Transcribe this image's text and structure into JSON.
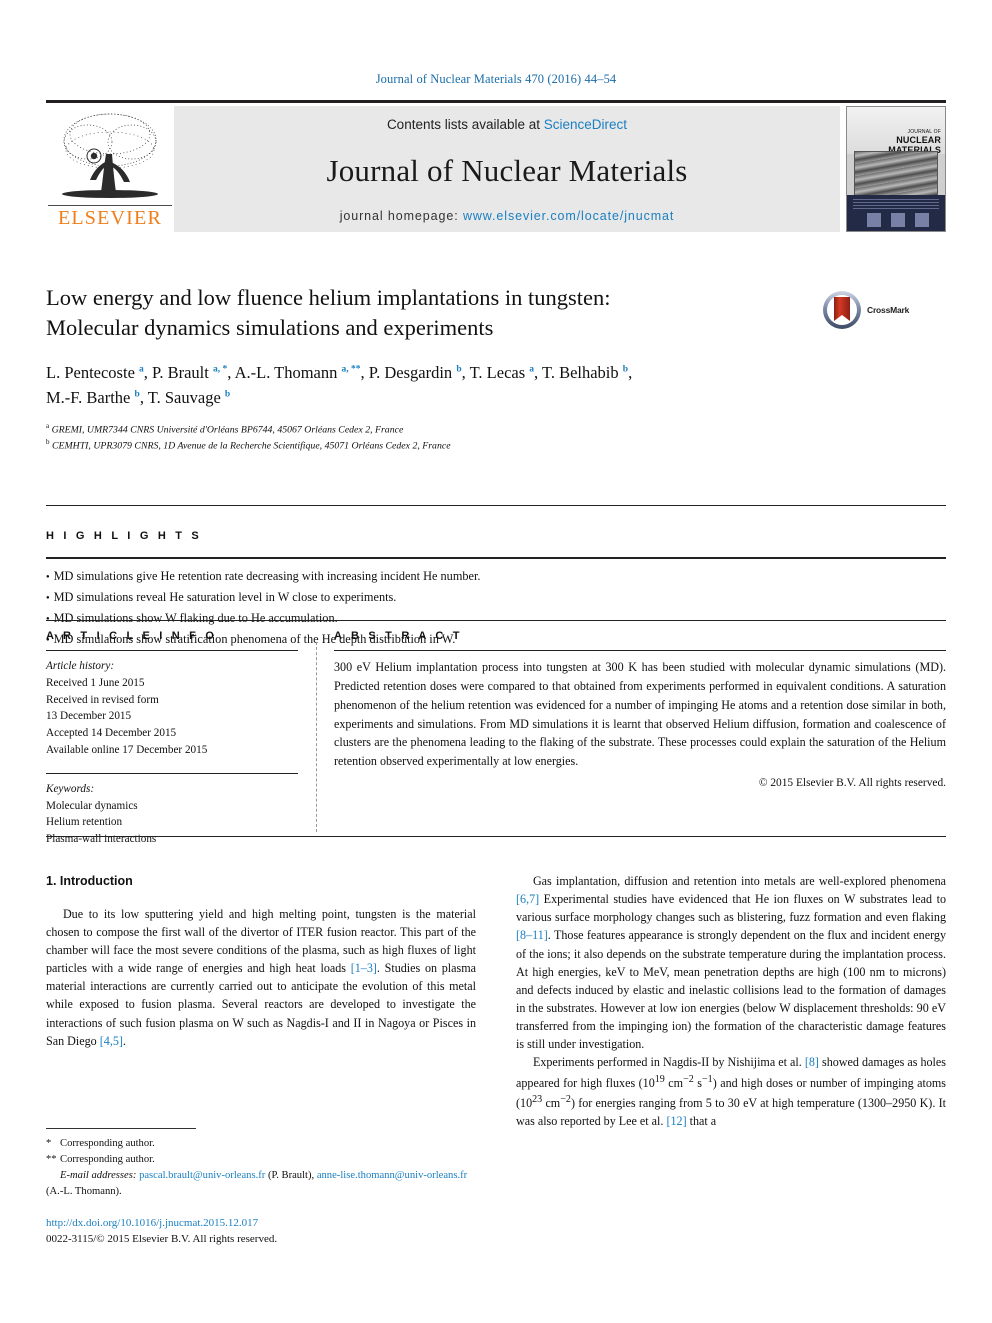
{
  "running_head": "Journal of Nuclear Materials 470 (2016) 44–54",
  "masthead": {
    "contents_prefix": "Contents lists available at ",
    "sciencedirect": "ScienceDirect",
    "journal_title": "Journal of Nuclear Materials",
    "homepage_prefix": "journal homepage: ",
    "homepage_url": "www.elsevier.com/locate/jnucmat",
    "publisher": "ELSEVIER",
    "cover_title_small": "JOURNAL OF",
    "cover_title_main": "NUCLEAR MATERIALS",
    "colors": {
      "link": "#1a7fc1",
      "elsevier_orange": "#ef7d1a",
      "band_gray": "#e8e8e8"
    }
  },
  "article": {
    "title_line1": "Low energy and low fluence helium implantations in tungsten:",
    "title_line2": "Molecular dynamics simulations and experiments",
    "crossmark_label": "CrossMark",
    "authors": [
      {
        "name": "L. Pentecoste",
        "marks": "a"
      },
      {
        "name": "P. Brault",
        "marks": "a, *"
      },
      {
        "name": "A.-L. Thomann",
        "marks": "a, **"
      },
      {
        "name": "P. Desgardin",
        "marks": "b"
      },
      {
        "name": "T. Lecas",
        "marks": "a"
      },
      {
        "name": "T. Belhabib",
        "marks": "b"
      },
      {
        "name": "M.-F. Barthe",
        "marks": "b"
      },
      {
        "name": "T. Sauvage",
        "marks": "b"
      }
    ],
    "affiliations": [
      {
        "mark": "a",
        "text": "GREMI, UMR7344 CNRS Université d'Orléans BP6744, 45067 Orléans Cedex 2, France"
      },
      {
        "mark": "b",
        "text": "CEMHTI, UPR3079 CNRS, 1D Avenue de la Recherche Scientifique, 45071 Orléans Cedex 2, France"
      }
    ]
  },
  "highlights": {
    "label": "H I G H L I G H T S",
    "items": [
      "MD simulations give He retention rate decreasing with increasing incident He number.",
      "MD simulations reveal He saturation level in W close to experiments.",
      "MD simulations show W flaking due to He accumulation.",
      "MD simulations show stratification phenomena of the He depth distribution in W."
    ]
  },
  "article_info": {
    "label": "A R T I C L E   I N F O",
    "history_label": "Article history:",
    "history": [
      "Received 1 June 2015",
      "Received in revised form",
      "13 December 2015",
      "Accepted 14 December 2015",
      "Available online 17 December 2015"
    ],
    "keywords_label": "Keywords:",
    "keywords": [
      "Molecular dynamics",
      "Helium retention",
      "Plasma-wall interactions"
    ]
  },
  "abstract": {
    "label": "A B S T R A C T",
    "text": "300 eV Helium implantation process into tungsten at 300 K has been studied with molecular dynamic simulations (MD). Predicted retention doses were compared to that obtained from experiments performed in equivalent conditions. A saturation phenomenon of the helium retention was evidenced for a number of impinging He atoms and a retention dose similar in both, experiments and simulations. From MD simulations it is learnt that observed Helium diffusion, formation and coalescence of clusters are the phenomena leading to the flaking of the substrate. These processes could explain the saturation of the Helium retention observed experimentally at low energies.",
    "copyright": "© 2015 Elsevier B.V. All rights reserved."
  },
  "body": {
    "section_heading": "1. Introduction",
    "left_paragraph": {
      "part1": "Due to its low sputtering yield and high melting point, tungsten is the material chosen to compose the first wall of the divertor of ITER fusion reactor. This part of the chamber will face the most severe conditions of the plasma, such as high fluxes of light particles with a wide range of energies and high heat loads ",
      "ref1": "[1–3]",
      "part2": ". Studies on plasma material interactions are currently carried out to anticipate the evolution of this metal while exposed to fusion plasma. Several reactors are developed to investigate the interactions of such fusion plasma on W such as Nagdis-I and II in Nagoya or Pisces in San Diego ",
      "ref2": "[4,5]",
      "part3": "."
    },
    "right_paragraph_1": {
      "part1": "Gas implantation, diffusion and retention into metals are well-explored phenomena ",
      "ref1": "[6,7]",
      "part2": " Experimental studies have evidenced that He ion fluxes on W substrates lead to various surface morphology changes such as blistering, fuzz formation and even flaking ",
      "ref2": "[8–11]",
      "part3": ". Those features appearance is strongly dependent on the flux and incident energy of the ions; it also depends on the substrate temperature during the implantation process. At high energies, keV to MeV, mean penetration depths are high (100 nm to microns) and defects induced by elastic and inelastic collisions lead to the formation of damages in the substrates. However at low ion energies (below W displacement thresholds: 90 eV transferred from the impinging ion) the formation of the characteristic damage features is still under investigation."
    },
    "right_paragraph_2": {
      "part1": "Experiments performed in Nagdis-II by Nishijima et al. ",
      "ref1": "[8]",
      "part2": " showed damages as holes appeared for high fluxes (10",
      "sup1": "19",
      "part3": " cm",
      "sup2": "−2",
      "part4": " s",
      "sup3": "−1",
      "part5": ") and high doses or number of impinging atoms (10",
      "sup4": "23",
      "part6": " cm",
      "sup5": "−2",
      "part7": ") for energies ranging from 5 to 30 eV at high temperature (1300–2950 K). It was also reported by Lee et al. ",
      "ref2": "[12]",
      "part8": " that a"
    }
  },
  "footnotes": {
    "corresponding_1": "Corresponding author.",
    "corresponding_2": "Corresponding author.",
    "email_label": "E-mail addresses:",
    "email_1": "pascal.brault@univ-orleans.fr",
    "email_1_owner": " (P. Brault), ",
    "email_2": "anne-lise.thomann@univ-orleans.fr",
    "email_2_owner": " (A.-L. Thomann)."
  },
  "doi_block": {
    "doi": "http://dx.doi.org/10.1016/j.jnucmat.2015.12.017",
    "issn_line": "0022-3115/© 2015 Elsevier B.V. All rights reserved."
  }
}
